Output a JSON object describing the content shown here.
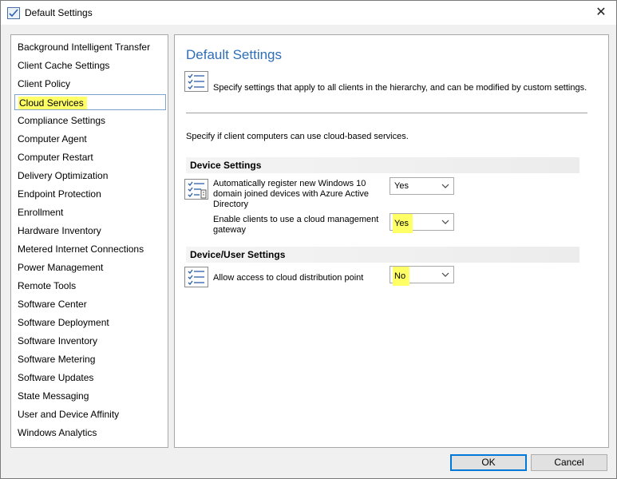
{
  "window": {
    "title": "Default Settings",
    "close_glyph": "✕"
  },
  "nav": {
    "items": [
      "Background Intelligent Transfer",
      "Client Cache Settings",
      "Client Policy",
      "Cloud Services",
      "Compliance Settings",
      "Computer Agent",
      "Computer Restart",
      "Delivery Optimization",
      "Endpoint Protection",
      "Enrollment",
      "Hardware Inventory",
      "Metered Internet Connections",
      "Power Management",
      "Remote Tools",
      "Software Center",
      "Software Deployment",
      "Software Inventory",
      "Software Metering",
      "Software Updates",
      "State Messaging",
      "User and Device Affinity",
      "Windows Analytics"
    ],
    "selected": "Cloud Services"
  },
  "main": {
    "title": "Default Settings",
    "description": "Specify settings that apply to all clients in the hierarchy, and can be modified by custom settings.",
    "subtitle": "Specify if client computers can use cloud-based services.",
    "sections": [
      {
        "header": "Device Settings",
        "settings": [
          {
            "label": "Automatically register new Windows 10 domain joined devices with Azure Active Directory",
            "value": "Yes"
          },
          {
            "label": "Enable clients to use a cloud management gateway",
            "value": "Yes"
          }
        ]
      },
      {
        "header": "Device/User Settings",
        "settings": [
          {
            "label": "Allow access to cloud distribution point",
            "value": "No"
          }
        ]
      }
    ]
  },
  "buttons": {
    "ok": "OK",
    "cancel": "Cancel"
  },
  "colors": {
    "accent": "#2f6eb8",
    "highlight": "#ffff66",
    "primary_border": "#0078d7"
  }
}
